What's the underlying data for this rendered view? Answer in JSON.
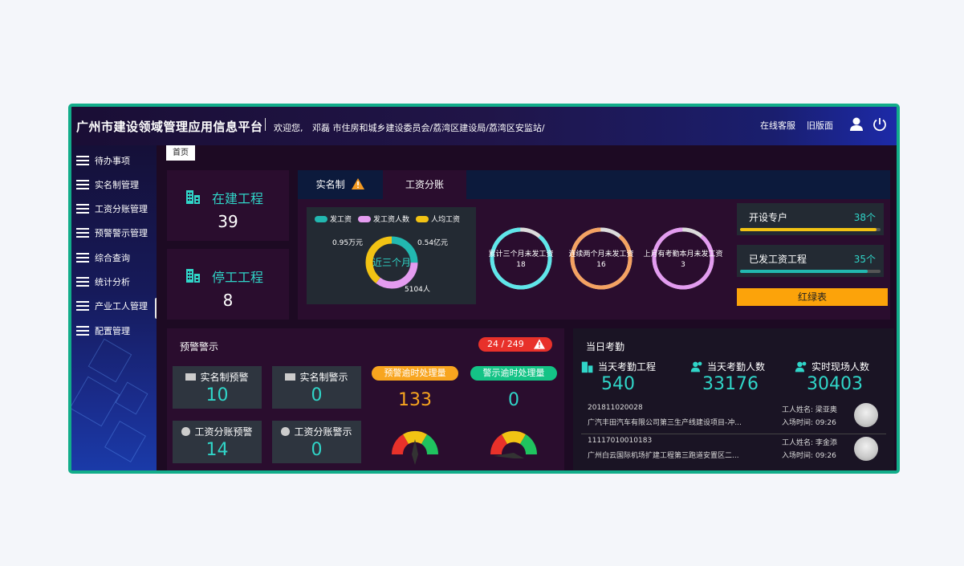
{
  "header": {
    "title": "广州市建设领域管理应用信息平台",
    "welcome": "欢迎您,",
    "user": "邓磊 市住房和城乡建设委员会/荔湾区建设局/荔湾区安监站/",
    "links": {
      "online_service": "在线客服",
      "old_version": "旧版面"
    }
  },
  "sidebar": {
    "items": [
      {
        "label": "待办事项"
      },
      {
        "label": "实名制管理"
      },
      {
        "label": "工资分账管理"
      },
      {
        "label": "预警警示管理"
      },
      {
        "label": "综合查询"
      },
      {
        "label": "统计分析"
      },
      {
        "label": "产业工人管理"
      },
      {
        "label": "配置管理"
      }
    ]
  },
  "breadcrumb": {
    "home": "首页"
  },
  "projects": {
    "in_progress": {
      "label": "在建工程",
      "value": "39"
    },
    "stopped": {
      "label": "停工工程",
      "value": "8"
    }
  },
  "tabs": [
    {
      "label": "实名制"
    },
    {
      "label": "工资分账"
    }
  ],
  "wage_chart": {
    "legend": [
      "发工资",
      "发工资人数",
      "人均工资"
    ],
    "center_label": "近三个月",
    "label_left": "0.95万元",
    "label_right": "0.54亿元",
    "label_bottom": "5104人",
    "colors": [
      "#22b8b0",
      "#e49cf0",
      "#f2c314"
    ]
  },
  "rings": [
    {
      "label": "累计三个月未发工资",
      "value": "18",
      "color": "#5fe6ea"
    },
    {
      "label": "连续两个月未发工资",
      "value": "16",
      "color": "#f4a262"
    },
    {
      "label": "上月有考勤本月未发工资",
      "value": "3",
      "color": "#e39cf0"
    }
  ],
  "accounts": {
    "opened": {
      "label": "开设专户",
      "value": "38个",
      "fill": 0.97,
      "color": "#f2c314"
    },
    "paid": {
      "label": "已发工资工程",
      "value": "35个",
      "fill": 0.91,
      "color": "#22b8b0"
    },
    "redgreen_button": "红绿表"
  },
  "warning": {
    "title": "预警警示",
    "badge": "24 / 249",
    "boxes": [
      {
        "label": "实名制预警",
        "value": "10"
      },
      {
        "label": "实名制警示",
        "value": "0"
      },
      {
        "label": "工资分账预警",
        "value": "14"
      },
      {
        "label": "工资分账警示",
        "value": "0"
      }
    ],
    "overdue_warning": {
      "label": "预警逾时处理量",
      "value": "133"
    },
    "overdue_alert": {
      "label": "警示逾时处理量",
      "value": "0"
    }
  },
  "attendance": {
    "title": "当日考勤",
    "stats": [
      {
        "label": "当天考勤工程",
        "value": "540"
      },
      {
        "label": "当天考勤人数",
        "value": "33176"
      },
      {
        "label": "实时现场人数",
        "value": "30403"
      }
    ],
    "records": [
      {
        "id": "201811020028",
        "project": "广汽丰田汽车有限公司第三生产线建设项目-冲...",
        "worker_label": "工人姓名:",
        "worker": "梁亚奥",
        "time_label": "入场时间:",
        "time": "09:26"
      },
      {
        "id": "11117010010183",
        "project": "广州白云国际机场扩建工程第三跑道安置区二...",
        "worker_label": "工人姓名:",
        "worker": "李金添",
        "time_label": "入场时间:",
        "time": "09:26"
      }
    ]
  }
}
